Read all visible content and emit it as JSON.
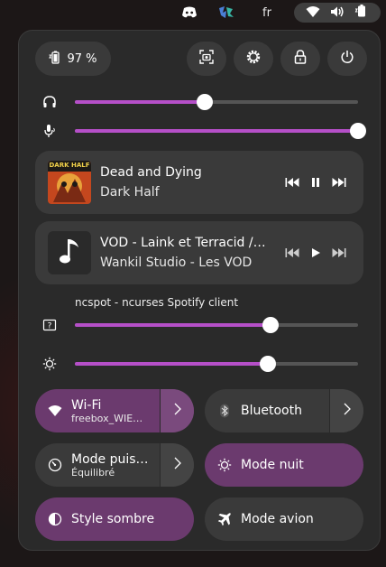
{
  "topbar": {
    "language": "fr",
    "icons": [
      "discord-icon",
      "app-tray-icon",
      "wifi-icon",
      "volume-icon",
      "battery-icon"
    ]
  },
  "header": {
    "battery_percent": "97 %",
    "buttons": [
      "screenshot-icon",
      "settings-icon",
      "lock-icon",
      "power-icon"
    ]
  },
  "sliders": {
    "output_volume": 0.46,
    "input_volume": 1.0,
    "app_volume": 0.69,
    "app_label": "ncspot - ncurses Spotify client",
    "brightness": 0.68
  },
  "media": [
    {
      "title": "Dead and Dying",
      "artist": "Dark Half",
      "state": "playing",
      "cover_text": "DARK HALF"
    },
    {
      "title": "VOD - Laink et Terracid // …",
      "artist": "Wankil Studio - Les VOD",
      "state": "paused"
    }
  ],
  "toggles": {
    "wifi": {
      "label": "Wi-Fi",
      "sub": "freebox_WIE…",
      "on": true
    },
    "bluetooth": {
      "label": "Bluetooth",
      "on": false
    },
    "power_mode": {
      "label": "Mode puis…",
      "sub": "Équilibré",
      "on": false
    },
    "night_mode": {
      "label": "Mode nuit",
      "on": true
    },
    "dark_style": {
      "label": "Style sombre",
      "on": true
    },
    "airplane": {
      "label": "Mode avion",
      "on": false
    }
  },
  "colors": {
    "accent": "#b54fc8",
    "toggle_on": "#6b3a6e",
    "panel_bg": "#2a2a2a",
    "button_bg": "#3a3a3a"
  }
}
